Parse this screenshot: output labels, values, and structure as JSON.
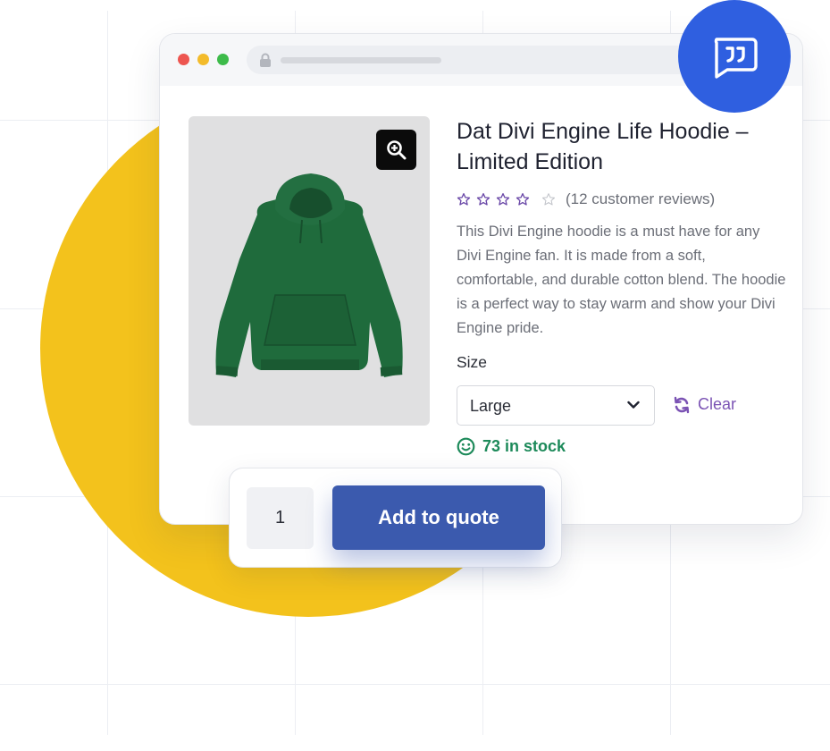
{
  "colors": {
    "accent_yellow": "#f3c21c",
    "chat_blue": "#2f5fe0",
    "button_blue": "#3b5aae",
    "star_purple": "#6b49a8",
    "clear_purple": "#7b53b4",
    "stock_green": "#1d8a5a"
  },
  "browser": {
    "window_controls": [
      "close",
      "minimize",
      "maximize"
    ],
    "address_icon": "lock-icon"
  },
  "product": {
    "title": "Dat Divi Engine Life Hoodie – Limited Edition",
    "rating": {
      "stars_filled": 4,
      "stars_total": 5,
      "reviews_text": "(12 customer reviews)"
    },
    "description": "This Divi Engine hoodie is a must have for any Divi Engine fan. It is made from a soft, comfortable, and durable cotton blend. The hoodie is a perfect way to stay warm and show your Divi Engine pride.",
    "size_label": "Size",
    "size_selected": "Large",
    "clear_label": "Clear",
    "stock_text": "73 in stock",
    "zoom_icon": "zoom-in-icon",
    "image_alt": "green hoodie"
  },
  "quote": {
    "quantity": "1",
    "button_label": "Add to quote"
  },
  "chat": {
    "icon": "quote-message-icon"
  }
}
